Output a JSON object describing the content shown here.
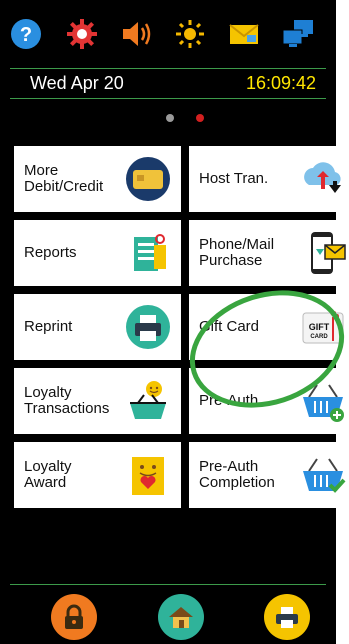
{
  "status": {
    "date": "Wed Apr 20",
    "time": "16:09:42",
    "icons": [
      "help-icon",
      "settings-gear-icon",
      "volume-icon",
      "brightness-icon",
      "message-icon",
      "network-icon"
    ]
  },
  "pager": {
    "pages": 2,
    "active": 2
  },
  "tiles": [
    {
      "label": "More\nDebit/Credit",
      "icon": "card-icon"
    },
    {
      "label": "Host Tran.",
      "icon": "cloud-transfer-icon"
    },
    {
      "label": "Reports",
      "icon": "reports-icon"
    },
    {
      "label": "Phone/Mail\nPurchase",
      "icon": "phone-mail-icon"
    },
    {
      "label": "Reprint",
      "icon": "printer-icon"
    },
    {
      "label": "Gift Card",
      "icon": "gift-card-icon",
      "icon_text": "GIFT CARD"
    },
    {
      "label": "Loyalty\nTransactions",
      "icon": "loyalty-basket-icon"
    },
    {
      "label": "Pre-Auth",
      "icon": "basket-plus-icon"
    },
    {
      "label": "Loyalty\nAward",
      "icon": "loyalty-award-icon"
    },
    {
      "label": "Pre-Auth\nCompletion",
      "icon": "basket-check-icon"
    }
  ],
  "bottom": [
    "lock-icon",
    "home-icon",
    "printer-icon"
  ],
  "colors": {
    "accent_green": "#39a53f",
    "time_yellow": "#ffe600",
    "active_dot": "#d32020",
    "inactive_dot": "#9a9a9a"
  }
}
